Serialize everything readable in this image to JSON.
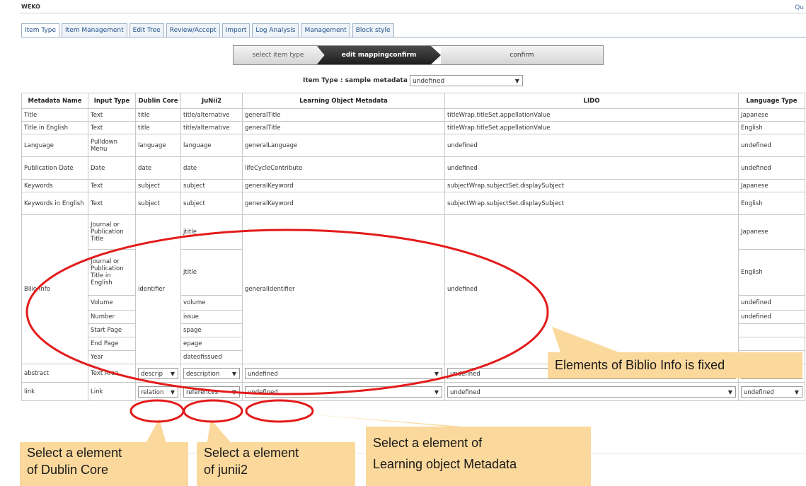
{
  "app": {
    "brand": "WEKO",
    "top_right": "Qu"
  },
  "tabs": [
    "Item Type",
    "Item Management",
    "Edit Tree",
    "Review/Accept",
    "Import",
    "Log Analysis",
    "Management",
    "Block style"
  ],
  "wizard": {
    "step1": "select item type",
    "step2": "edit mappingconfirm",
    "step3": "confirm"
  },
  "item_type": {
    "label": "Item Type : sample metadata",
    "value": "undefined"
  },
  "table": {
    "headers": [
      "Metadata Name",
      "Input Type",
      "Dublin Core",
      "JuNii2",
      "Learning Object Metadata",
      "LIDO",
      "Language Type"
    ],
    "rows": [
      [
        "Title",
        "Text",
        "title",
        "title/alternative",
        "generalTitle",
        "titleWrap.titleSet.appellationValue",
        "Japanese"
      ],
      [
        "Title in English",
        "Text",
        "title",
        "title/alternative",
        "generalTitle",
        "titleWrap.titleSet.appellationValue",
        "English"
      ],
      [
        "Language",
        "Pulldown Menu",
        "language",
        "language",
        "generalLanguage",
        "undefined",
        "undefined"
      ],
      [
        "Publication Date",
        "Date",
        "date",
        "date",
        "lifeCycleContribute",
        "undefined",
        "undefined"
      ],
      [
        "Keywords",
        "Text",
        "subject",
        "subject",
        "generalKeyword",
        "subjectWrap.subjectSet.displaySubject",
        "Japanese"
      ],
      [
        "Keywords in English",
        "Text",
        "subject",
        "subject",
        "generalKeyword",
        "subjectWrap.subjectSet.displaySubject",
        "English"
      ]
    ],
    "biblio": {
      "name": "Bilio Info",
      "dublin": "identifier",
      "lom": "generalIdentifier",
      "lido": "undefined",
      "rows": [
        {
          "input": "Journal or Publication Title",
          "junii": "jtitle",
          "lang": "Japanese"
        },
        {
          "input": "Journal or Publication Title in English",
          "junii": "jtitle",
          "lang": "English"
        },
        {
          "input": "Volume",
          "junii": "volume",
          "lang": "undefined"
        },
        {
          "input": "Number",
          "junii": "issue",
          "lang": "undefined"
        },
        {
          "input": "Start Page",
          "junii": "spage",
          "lang": ""
        },
        {
          "input": "End Page",
          "junii": "epage",
          "lang": ""
        },
        {
          "input": "Year",
          "junii": "dateofissued",
          "lang": ""
        }
      ]
    },
    "abstract": {
      "name": "abstract",
      "input": "Text Area",
      "dublin": "descrip",
      "junii": "description",
      "lom": "undefined",
      "lido": "undefined",
      "lang": "undefined"
    },
    "link": {
      "name": "link",
      "input": "Link",
      "dublin": "relation",
      "junii": "references",
      "lom": "undefined",
      "lido": "undefined",
      "lang": "undefined"
    }
  },
  "callouts": {
    "biblio": "Elements of Biblio Info is fixed",
    "dublin_1": "Select a element",
    "dublin_2": "of Dublin Core",
    "junii_1": "Select a element",
    "junii_2": "of junii2",
    "lom_1": "Select a element of",
    "lom_2": "Learning object Metadata"
  },
  "colors": {
    "annotation_red": "#e31b1b",
    "callout_fill": "#fbd89c",
    "tab_text": "#1f4e8c"
  }
}
